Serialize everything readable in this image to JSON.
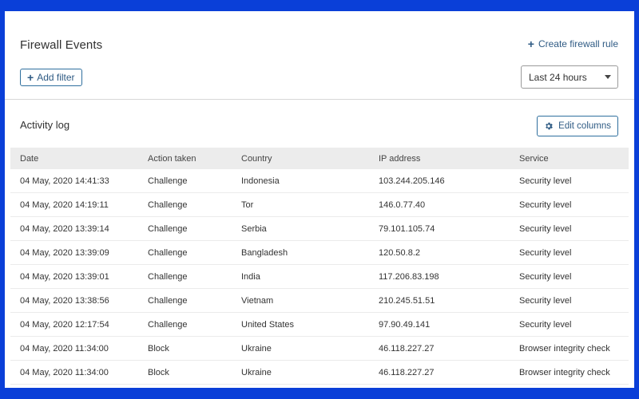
{
  "header": {
    "title": "Firewall Events",
    "create_rule_label": "Create firewall rule",
    "add_filter_label": "Add filter",
    "time_range": "Last 24 hours"
  },
  "activity": {
    "title": "Activity log",
    "edit_columns_label": "Edit columns",
    "columns": [
      "Date",
      "Action taken",
      "Country",
      "IP address",
      "Service"
    ],
    "rows": [
      [
        "04 May, 2020 14:41:33",
        "Challenge",
        "Indonesia",
        "103.244.205.146",
        "Security level"
      ],
      [
        "04 May, 2020 14:19:11",
        "Challenge",
        "Tor",
        "146.0.77.40",
        "Security level"
      ],
      [
        "04 May, 2020 13:39:14",
        "Challenge",
        "Serbia",
        "79.101.105.74",
        "Security level"
      ],
      [
        "04 May, 2020 13:39:09",
        "Challenge",
        "Bangladesh",
        "120.50.8.2",
        "Security level"
      ],
      [
        "04 May, 2020 13:39:01",
        "Challenge",
        "India",
        "117.206.83.198",
        "Security level"
      ],
      [
        "04 May, 2020 13:38:56",
        "Challenge",
        "Vietnam",
        "210.245.51.51",
        "Security level"
      ],
      [
        "04 May, 2020 12:17:54",
        "Challenge",
        "United States",
        "97.90.49.141",
        "Security level"
      ],
      [
        "04 May, 2020 11:34:00",
        "Block",
        "Ukraine",
        "46.118.227.27",
        "Browser integrity check"
      ],
      [
        "04 May, 2020 11:34:00",
        "Block",
        "Ukraine",
        "46.118.227.27",
        "Browser integrity check"
      ]
    ]
  },
  "colors": {
    "frame": "#0a3fd8",
    "accent": "#2f5b84"
  }
}
